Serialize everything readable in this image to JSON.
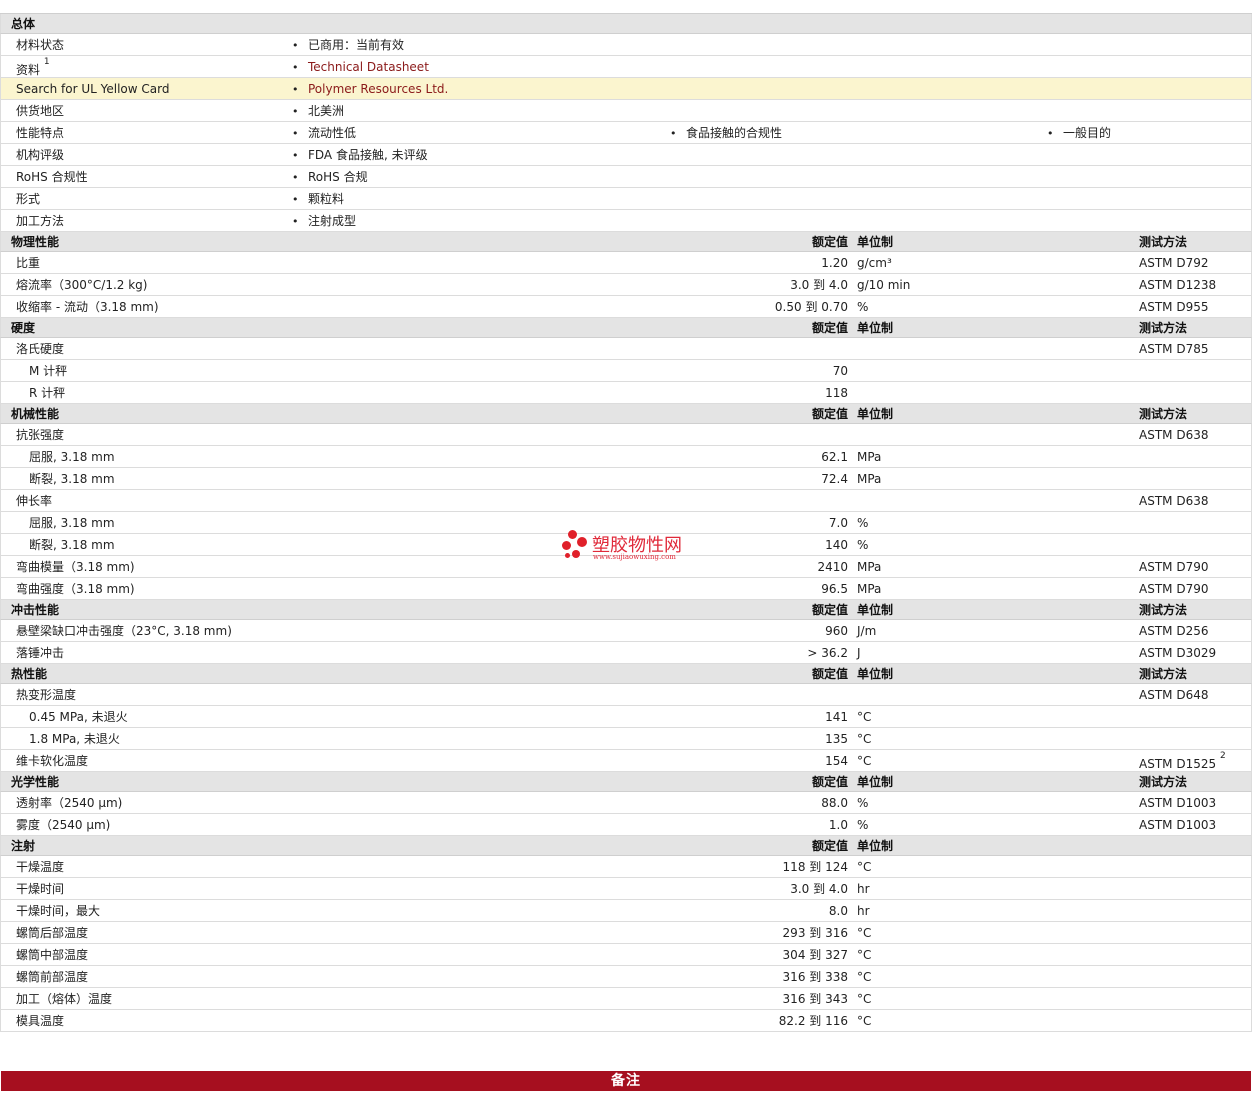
{
  "general": {
    "title": "总体",
    "rows": [
      {
        "label": "材料状态",
        "items": [
          "已商用：当前有效"
        ]
      },
      {
        "label": "资料",
        "sup": "1",
        "items": [
          "Technical Datasheet"
        ],
        "link": true
      },
      {
        "label": "Search for UL Yellow Card",
        "items": [
          "Polymer Resources Ltd."
        ],
        "link": true,
        "highlight": true
      },
      {
        "label": "供货地区",
        "items": [
          "北美洲"
        ]
      },
      {
        "label": "性能特点",
        "items": [
          "流动性低",
          "食品接触的合规性",
          "一般目的"
        ]
      },
      {
        "label": "机构评级",
        "items": [
          "FDA 食品接触, 未评级"
        ]
      },
      {
        "label": "RoHS 合规性",
        "items": [
          "RoHS 合规"
        ]
      },
      {
        "label": "形式",
        "items": [
          "颗粒料"
        ]
      },
      {
        "label": "加工方法",
        "items": [
          "注射成型"
        ]
      }
    ]
  },
  "headers": {
    "value": "额定值",
    "unit": "单位制",
    "test": "测试方法"
  },
  "sections": [
    {
      "title": "物理性能",
      "rows": [
        {
          "label": "比重",
          "value": "1.20",
          "unit": "g/cm³",
          "test": "ASTM D792"
        },
        {
          "label": "熔流率（300°C/1.2 kg)",
          "value": "3.0 到  4.0",
          "unit": "g/10 min",
          "test": "ASTM D1238"
        },
        {
          "label": "收缩率 - 流动（3.18 mm)",
          "value": "0.50 到  0.70",
          "unit": "%",
          "test": "ASTM D955"
        }
      ]
    },
    {
      "title": "硬度",
      "rows": [
        {
          "label": "洛氏硬度",
          "value": "",
          "unit": "",
          "test": "ASTM D785"
        },
        {
          "label": "M 计秤",
          "value": "70",
          "unit": "",
          "test": "",
          "sub": true
        },
        {
          "label": "R 计秤",
          "value": "118",
          "unit": "",
          "test": "",
          "sub": true
        }
      ]
    },
    {
      "title": "机械性能",
      "rows": [
        {
          "label": "抗张强度",
          "value": "",
          "unit": "",
          "test": "ASTM D638"
        },
        {
          "label": "屈服, 3.18 mm",
          "value": "62.1",
          "unit": "MPa",
          "test": "",
          "sub": true
        },
        {
          "label": "断裂, 3.18 mm",
          "value": "72.4",
          "unit": "MPa",
          "test": "",
          "sub": true
        },
        {
          "label": "伸长率",
          "value": "",
          "unit": "",
          "test": "ASTM D638"
        },
        {
          "label": "屈服, 3.18 mm",
          "value": "7.0",
          "unit": "%",
          "test": "",
          "sub": true
        },
        {
          "label": "断裂, 3.18 mm",
          "value": "140",
          "unit": "%",
          "test": "",
          "sub": true
        },
        {
          "label": "弯曲模量（3.18 mm)",
          "value": "2410",
          "unit": "MPa",
          "test": "ASTM D790"
        },
        {
          "label": "弯曲强度（3.18 mm)",
          "value": "96.5",
          "unit": "MPa",
          "test": "ASTM D790"
        }
      ]
    },
    {
      "title": "冲击性能",
      "rows": [
        {
          "label": "悬壁梁缺口冲击强度（23°C, 3.18 mm)",
          "value": "960",
          "unit": "J/m",
          "test": "ASTM D256"
        },
        {
          "label": "落锤冲击",
          "value": "> 36.2",
          "unit": "J",
          "test": "ASTM D3029"
        }
      ]
    },
    {
      "title": "热性能",
      "rows": [
        {
          "label": "热变形温度",
          "value": "",
          "unit": "",
          "test": "ASTM D648"
        },
        {
          "label": "0.45 MPa, 未退火",
          "value": "141",
          "unit": "°C",
          "test": "",
          "sub": true
        },
        {
          "label": "1.8 MPa, 未退火",
          "value": "135",
          "unit": "°C",
          "test": "",
          "sub": true
        },
        {
          "label": "维卡软化温度",
          "value": "154",
          "unit": "°C",
          "test": "ASTM D1525",
          "test_sup": "2"
        }
      ]
    },
    {
      "title": "光学性能",
      "rows": [
        {
          "label": "透射率（2540 µm)",
          "value": "88.0",
          "unit": "%",
          "test": "ASTM D1003"
        },
        {
          "label": "雾度（2540 µm)",
          "value": "1.0",
          "unit": "%",
          "test": "ASTM D1003"
        }
      ]
    },
    {
      "title": "注射",
      "test_header": false,
      "rows": [
        {
          "label": "干燥温度",
          "value": "118 到  124",
          "unit": "°C",
          "test": ""
        },
        {
          "label": "干燥时间",
          "value": "3.0 到  4.0",
          "unit": "hr",
          "test": ""
        },
        {
          "label": "干燥时间，最大",
          "value": "8.0",
          "unit": "hr",
          "test": ""
        },
        {
          "label": "螺筒后部温度",
          "value": "293 到  316",
          "unit": "°C",
          "test": ""
        },
        {
          "label": "螺筒中部温度",
          "value": "304 到  327",
          "unit": "°C",
          "test": ""
        },
        {
          "label": "螺筒前部温度",
          "value": "316 到  338",
          "unit": "°C",
          "test": ""
        },
        {
          "label": "加工（熔体）温度",
          "value": "316 到  343",
          "unit": "°C",
          "test": ""
        },
        {
          "label": "模具温度",
          "value": "82.2 到  116",
          "unit": "°C",
          "test": ""
        }
      ]
    }
  ],
  "notes_bar": "备注",
  "watermark": {
    "text": "塑胶物性网",
    "url": "www.sujiaowuxing.com",
    "color": "#e0202a"
  }
}
